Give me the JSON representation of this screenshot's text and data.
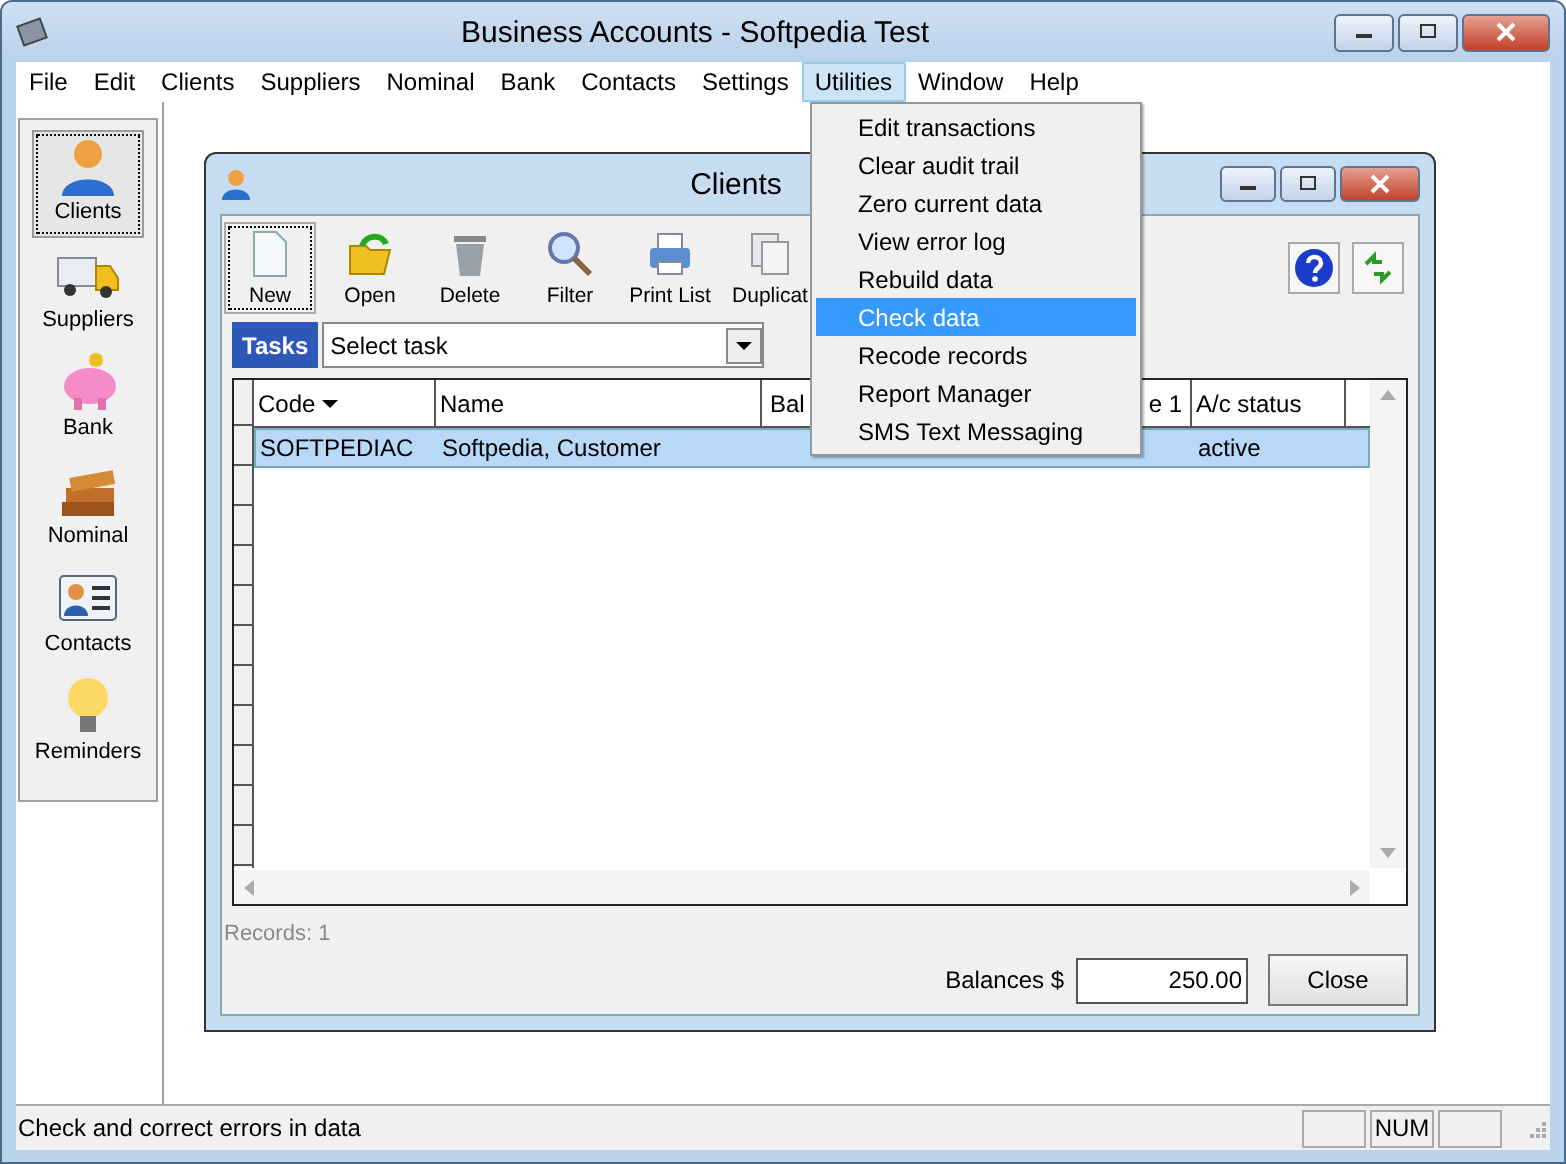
{
  "window": {
    "title": "Business Accounts - Softpedia Test"
  },
  "menubar": [
    {
      "label": "File",
      "selected": false
    },
    {
      "label": "Edit",
      "selected": false
    },
    {
      "label": "Clients",
      "selected": false
    },
    {
      "label": "Suppliers",
      "selected": false
    },
    {
      "label": "Nominal",
      "selected": false
    },
    {
      "label": "Bank",
      "selected": false
    },
    {
      "label": "Contacts",
      "selected": false
    },
    {
      "label": "Settings",
      "selected": false
    },
    {
      "label": "Utilities",
      "selected": true
    },
    {
      "label": "Window",
      "selected": false
    },
    {
      "label": "Help",
      "selected": false
    }
  ],
  "sidebar": {
    "items": [
      {
        "label": "Clients",
        "kind": "person",
        "selected": true
      },
      {
        "label": "Suppliers",
        "kind": "truck",
        "selected": false
      },
      {
        "label": "Bank",
        "kind": "piggy",
        "selected": false
      },
      {
        "label": "Nominal",
        "kind": "books",
        "selected": false
      },
      {
        "label": "Contacts",
        "kind": "card",
        "selected": false
      },
      {
        "label": "Reminders",
        "kind": "bulb",
        "selected": false
      }
    ]
  },
  "child_window": {
    "title": "Clients",
    "toolbar": [
      {
        "label": "New",
        "kind": "page",
        "selected": true
      },
      {
        "label": "Open",
        "kind": "folder",
        "selected": false
      },
      {
        "label": "Delete",
        "kind": "bin",
        "selected": false
      },
      {
        "label": "Filter",
        "kind": "magnifier",
        "selected": false
      },
      {
        "label": "Print List",
        "kind": "printer",
        "selected": false
      },
      {
        "label": "Duplicat",
        "kind": "copy",
        "selected": false
      }
    ],
    "tasks": {
      "label": "Tasks",
      "value": "Select task"
    },
    "table": {
      "columns": [
        {
          "label": "Code",
          "sorted": true
        },
        {
          "label": "Name",
          "sorted": false
        },
        {
          "label": "Bal",
          "sorted": false
        },
        {
          "label": "e 1",
          "sorted": false
        },
        {
          "label": "A/c status",
          "sorted": false
        }
      ],
      "rows": [
        {
          "cells": [
            "SOFTPEDIAC",
            "Softpedia, Customer",
            "",
            "",
            "active"
          ],
          "selected": true
        }
      ]
    },
    "records": "Records: 1",
    "balances": {
      "label": "Balances $",
      "value": "250.00"
    },
    "close_button": "Close"
  },
  "utilities_menu": [
    {
      "label": "Edit transactions",
      "selected": false
    },
    {
      "label": "Clear audit trail",
      "selected": false
    },
    {
      "label": "Zero current data",
      "selected": false
    },
    {
      "label": "View error log",
      "selected": false
    },
    {
      "label": "Rebuild data",
      "selected": false
    },
    {
      "label": "Check data",
      "selected": true
    },
    {
      "label": "Recode records",
      "selected": false
    },
    {
      "label": "Report Manager",
      "selected": false
    },
    {
      "label": "SMS Text Messaging",
      "selected": false
    }
  ],
  "status_bar": {
    "message": "Check and correct errors in data",
    "num_indicator": "NUM"
  }
}
